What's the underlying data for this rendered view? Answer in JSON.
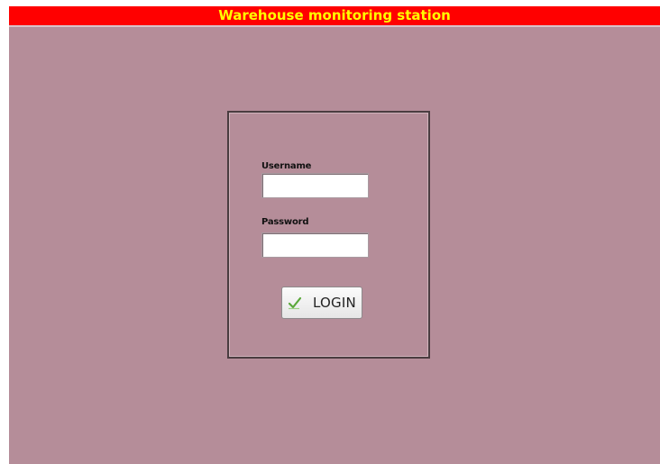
{
  "window": {
    "title": "Warehouse monitoring station"
  },
  "login": {
    "username_label": "Username",
    "username_value": "",
    "password_label": "Password",
    "password_value": "",
    "button_label": "LOGIN",
    "button_icon": "check-icon"
  },
  "colors": {
    "title_bar": "#ff0000",
    "title_text": "#ffff00",
    "background": "#b58d99",
    "panel_border": "#4a3c40"
  }
}
